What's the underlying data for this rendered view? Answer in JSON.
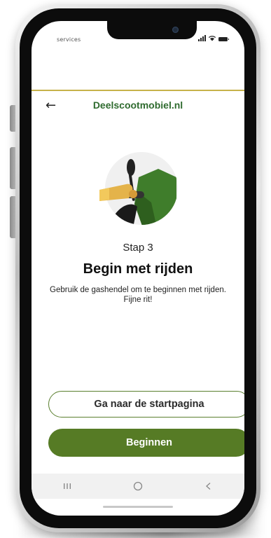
{
  "status_bar": {
    "carrier": "services"
  },
  "header": {
    "back_icon": "arrow-left-icon",
    "brand": "Deelscootmobiel.nl"
  },
  "content": {
    "step": "Stap 3",
    "title": "Begin met rijden",
    "description": "Gebruik de gashendel om te beginnen met rijden. Fijne rit!"
  },
  "buttons": {
    "home_label": "Ga naar de startpagina",
    "start_label": "Beginnen"
  },
  "navbar": {
    "items": [
      "recent-apps-icon",
      "home-icon",
      "back-icon"
    ]
  },
  "colors": {
    "brand_green": "#2f6b2f",
    "button_green": "#567b25",
    "header_rule": "#c6b24a"
  }
}
